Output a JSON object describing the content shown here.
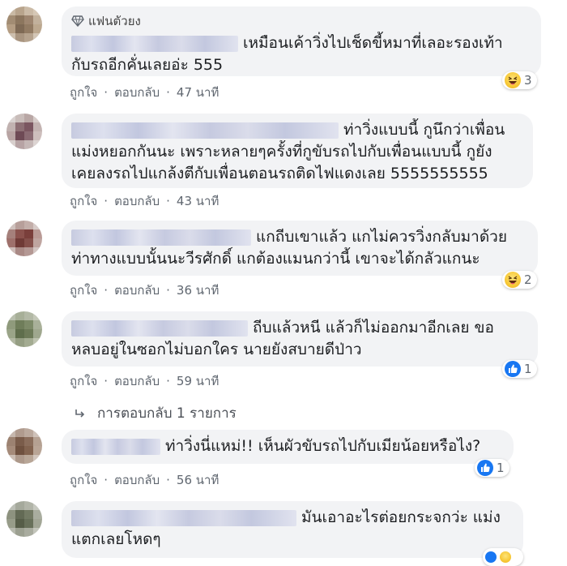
{
  "actions": {
    "like": "ถูกใจ",
    "reply": "ตอบกลับ",
    "sep": "·"
  },
  "comments": [
    {
      "badge": "แฟนตัวยง",
      "lines": [
        "เหมือนเค้าวิ่งไปเช็ดขี้หมาที่เลอะรองเท้า",
        "กับรถอีกคั่นเลยอ่ะ 555"
      ],
      "time": "47 นาที",
      "reaction": {
        "type": "haha",
        "count": "3"
      }
    },
    {
      "lines": [
        "ท่าวิ่งแบบนี้ กูนึกว่าเพื่อน",
        "แม่งหยอกกันนะ เพราะหลายๆครั้งที่กูขับรถไปกับเพื่อนแบบนี้ กูยัง",
        "เคยลงรถไปแกล้งตีกับเพื่อนตอนรถติดไฟแดงเลย 5555555555"
      ],
      "time": "43 นาที"
    },
    {
      "lines": [
        "แกถีบเขาแล้ว แกไม่ควรวิ่งกลับมาด้วย",
        "ท่าทางแบบนั้นนะวีรศักดิ์ แกต้องแมนกว่านี้ เขาจะได้กลัวแกนะ"
      ],
      "time": "36 นาที",
      "reaction": {
        "type": "haha",
        "count": "2"
      }
    },
    {
      "lines": [
        "ถีบแล้วหนี แล้วก็ไม่ออกมาอีกเลย ขอ",
        "หลบอยู่ในซอกไม่บอกใคร นายยังสบายดีป่าว"
      ],
      "time": "59 นาที",
      "reaction": {
        "type": "like",
        "count": "1"
      }
    },
    {
      "lines": [
        "ท่าวิ่งนี่แหม่!! เห็นผัวขับรถไปกับเมียน้อยหรือไง?"
      ],
      "time": "56 นาที",
      "reaction": {
        "type": "like",
        "count": "1"
      }
    },
    {
      "lines": [
        "มันเอาอะไรต่อยกระจกว่ะ แม่ง",
        "แตกเลยโหดๆ"
      ]
    }
  ],
  "replies_link": "การตอบกลับ 1 รายการ",
  "colors": {
    "bubble": "#f2f3f5",
    "like_blue": "#1877f2",
    "haha_yellow": "#f7c836"
  }
}
